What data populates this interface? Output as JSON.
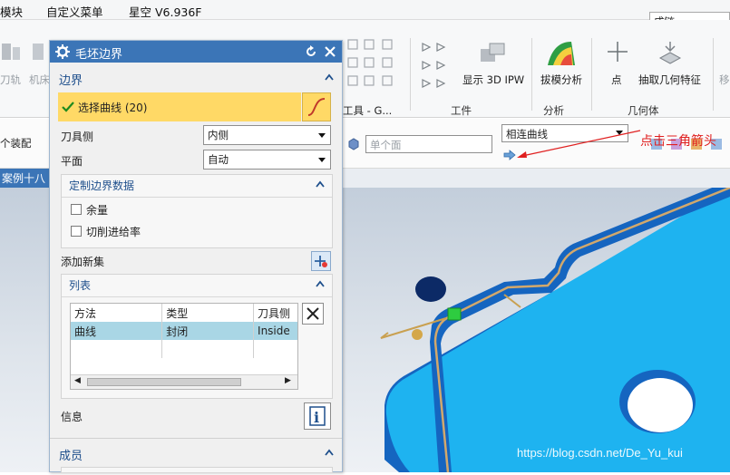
{
  "menubar": {
    "items": [
      "模块",
      "自定义菜单",
      "星空 V6.936F"
    ],
    "search_value": "成链"
  },
  "ribbon": {
    "partial_left_labels": [
      "刀轨",
      "机床"
    ],
    "group_tools_label": "工具 - G...",
    "show_3d_ipw": "显示 3D IPW",
    "workpiece_label": "工件",
    "draft_analysis": "拔模分析",
    "analysis_label": "分析",
    "point": "点",
    "extract_geometry": "抽取几何特征",
    "geometry_label": "几何体",
    "partial_right_label": "移"
  },
  "toolbar2": {
    "left_text": "个装配",
    "face_filter": "单个面",
    "curve_rule": "相连曲线"
  },
  "tab": {
    "label": "案例十八"
  },
  "annotation": "点击三角箭头",
  "watermark": "https://blog.csdn.net/De_Yu_kui",
  "dialog": {
    "title": "毛坯边界",
    "section_boundary": "边界",
    "select_curve": "选择曲线 (20)",
    "tool_side_label": "刀具侧",
    "tool_side_value": "内侧",
    "plane_label": "平面",
    "plane_value": "自动",
    "custom_data": {
      "title": "定制边界数据",
      "allowance": "余量",
      "feed_rate": "切削进给率"
    },
    "add_new_set": "添加新集",
    "list": {
      "title": "列表",
      "headers": [
        "方法",
        "类型",
        "刀具侧"
      ],
      "rows": [
        [
          "曲线",
          "封闭",
          "Inside"
        ]
      ]
    },
    "info_label": "信息",
    "members_label": "成员"
  },
  "colors": {
    "title_bar": "#3b75b7",
    "selection_highlight": "#ffd966",
    "part_cyan": "#1eb3f0",
    "part_side_blue": "#1565c0",
    "annotation_red": "#e02020"
  }
}
